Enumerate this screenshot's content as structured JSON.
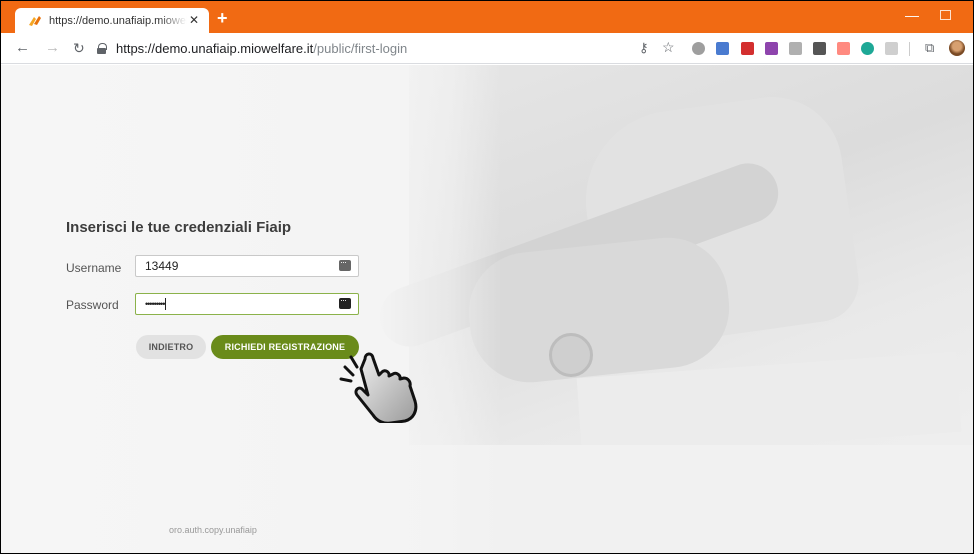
{
  "browser": {
    "tab_title": "https://demo.unafiaip.miowelfare.it/public/first-login",
    "tab_close": "✕",
    "new_tab": "+",
    "url_host": "https://demo.unafiaip.miowelfare.it",
    "url_path": "/public/first-login",
    "colors": {
      "titlebar": "#f16a13",
      "accent_button": "#6a8b1a"
    }
  },
  "login": {
    "title": "Inserisci le tue credenziali Fiaip",
    "username_label": "Username",
    "username_value": "13449",
    "password_label": "Password",
    "password_value": "•••••••••",
    "back_button": "INDIETRO",
    "register_button": "RICHIEDI REGISTRAZIONE"
  },
  "footer": {
    "text": "oro.auth.copy.unafiaip"
  },
  "icons": [
    "favicon-icon",
    "back-arrow-icon",
    "forward-arrow-icon",
    "reload-icon",
    "lock-icon",
    "key-icon",
    "star-icon",
    "extension-icons",
    "cast-icon",
    "profile-avatar",
    "password-manager-icon",
    "pointer-hand-icon"
  ]
}
